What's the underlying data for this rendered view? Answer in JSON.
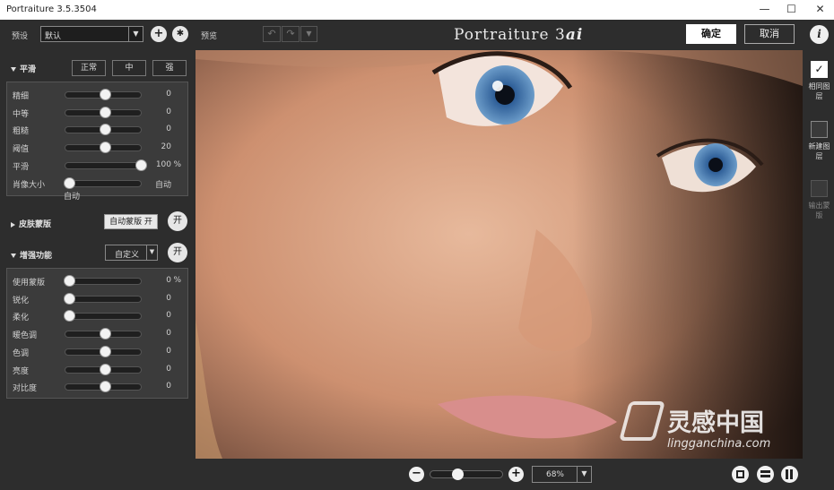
{
  "window": {
    "title": "Portraiture 3.5.3504",
    "minimize": "—",
    "maximize": "☐",
    "close": "✕"
  },
  "preset": {
    "label": "预设",
    "value": "默认",
    "add": "+",
    "settings": "✱"
  },
  "smooth": {
    "title": "平滑",
    "buttons": [
      "正常",
      "中",
      "强"
    ],
    "sliders": [
      {
        "name": "精细",
        "value": "0",
        "unit": "",
        "pos": 0.5
      },
      {
        "name": "中等",
        "value": "0",
        "unit": "",
        "pos": 0.5
      },
      {
        "name": "粗糙",
        "value": "0",
        "unit": "",
        "pos": 0.5
      },
      {
        "name": "阈值",
        "value": "20",
        "unit": "",
        "pos": 0.5
      },
      {
        "name": "平滑",
        "value": "100",
        "unit": "%",
        "pos": 1.0
      },
      {
        "name": "肖像大小",
        "value": "自动",
        "unit": "",
        "pos": 0.0
      }
    ],
    "auto_label": "自动"
  },
  "skinmask": {
    "title": "皮肤蒙版",
    "auto_button": "自动蒙版 开",
    "toggle": "开"
  },
  "enhance": {
    "title": "增强功能",
    "preset_value": "自定义",
    "toggle": "开",
    "sliders": [
      {
        "name": "使用蒙版",
        "value": "0",
        "unit": "%",
        "pos": 0.0
      },
      {
        "name": "锐化",
        "value": "0",
        "unit": "",
        "pos": 0.0
      },
      {
        "name": "柔化",
        "value": "0",
        "unit": "",
        "pos": 0.0
      },
      {
        "name": "暖色调",
        "value": "0",
        "unit": "",
        "pos": 0.5
      },
      {
        "name": "色调",
        "value": "0",
        "unit": "",
        "pos": 0.5
      },
      {
        "name": "亮度",
        "value": "0",
        "unit": "",
        "pos": 0.5
      },
      {
        "name": "对比度",
        "value": "0",
        "unit": "",
        "pos": 0.5
      }
    ]
  },
  "topbar": {
    "preview_label": "预览",
    "brand_main": "Portraiture 3",
    "brand_suffix": "ai",
    "ok": "确定",
    "cancel": "取消",
    "info": "i"
  },
  "right": {
    "same_layer": "相同图层",
    "new_layer": "新建图层",
    "output_mask": "输出蒙版"
  },
  "bottom": {
    "zoom": "68%",
    "zoom_pos": 0.35,
    "minus": "−",
    "plus": "+"
  },
  "watermark": {
    "cn": "灵感中国",
    "url": "lingganchina.com"
  }
}
